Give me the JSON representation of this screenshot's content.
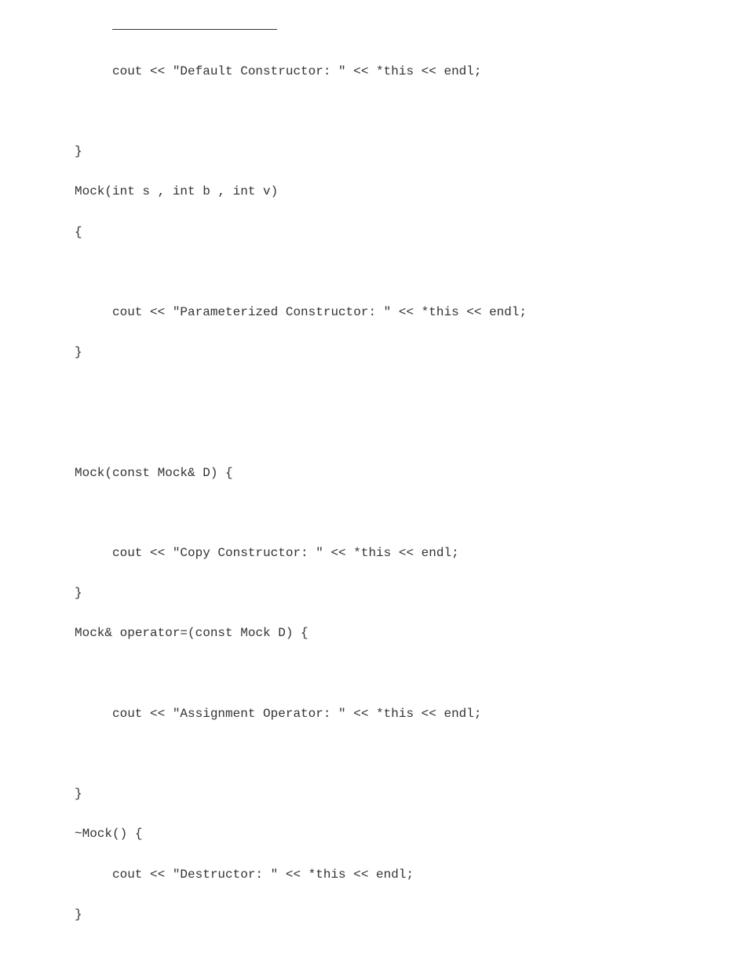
{
  "code": {
    "l01": "cout << \"Default Constructor: \" << *this << endl;",
    "l02": "",
    "l03": "}",
    "l04": "Mock(int s , int b , int v)",
    "l05": "{",
    "l06": "",
    "l07": "cout << \"Parameterized Constructor: \" << *this << endl;",
    "l08": "}",
    "l09": "",
    "l10": "",
    "l11": "Mock(const Mock& D) {",
    "l12": "",
    "l13": "cout << \"Copy Constructor: \" << *this << endl;",
    "l14": "}",
    "l15": "Mock& operator=(const Mock D) {",
    "l16": "",
    "l17": "cout << \"Assignment Operator: \" << *this << endl;",
    "l18": "",
    "l19": "}",
    "l20": "~Mock() {",
    "l21": "cout << \"Destructor: \" << *this << endl;",
    "l22": "}"
  }
}
